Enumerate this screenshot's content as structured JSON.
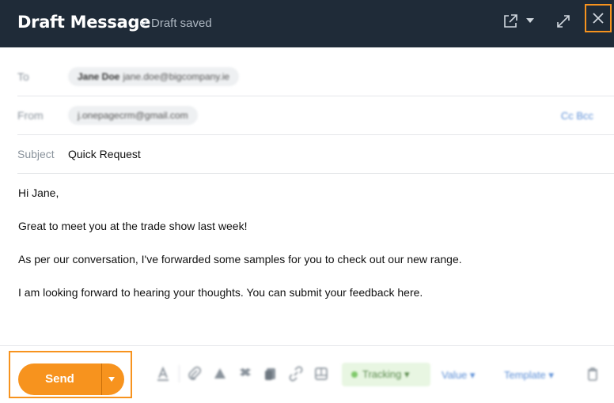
{
  "header": {
    "title": "Draft Message",
    "status": "Draft saved"
  },
  "fields": {
    "to": {
      "label": "To",
      "recipient_name": "Jane Doe",
      "recipient_email": "jane.doe@bigcompany.ie"
    },
    "from": {
      "label": "From",
      "value": "j.onepagecrm@gmail.com",
      "cc_bcc_label": "Cc Bcc"
    },
    "subject": {
      "label": "Subject",
      "value": "Quick Request"
    }
  },
  "body": {
    "lines": [
      "Hi Jane,",
      "Great to meet you at the trade show last week!",
      "As per our conversation, I've forwarded some samples for you to check out our new range.",
      "I am looking forward to hearing your thoughts. You can submit your feedback here."
    ]
  },
  "footer": {
    "send_label": "Send",
    "tracking_label": "Tracking",
    "value_label": "Value",
    "template_label": "Template"
  },
  "colors": {
    "header_bg": "#1f2b38",
    "accent": "#f7931e",
    "link": "#5b8ed6",
    "tracking_bg": "#e8f6e2"
  },
  "icons": [
    "check-icon",
    "popout-icon",
    "caret-down-icon",
    "expand-icon",
    "close-icon",
    "text-format-icon",
    "attachment-icon",
    "cloud-upload-icon",
    "dropbox-icon",
    "document-icon",
    "link-icon",
    "image-icon",
    "trash-icon"
  ]
}
